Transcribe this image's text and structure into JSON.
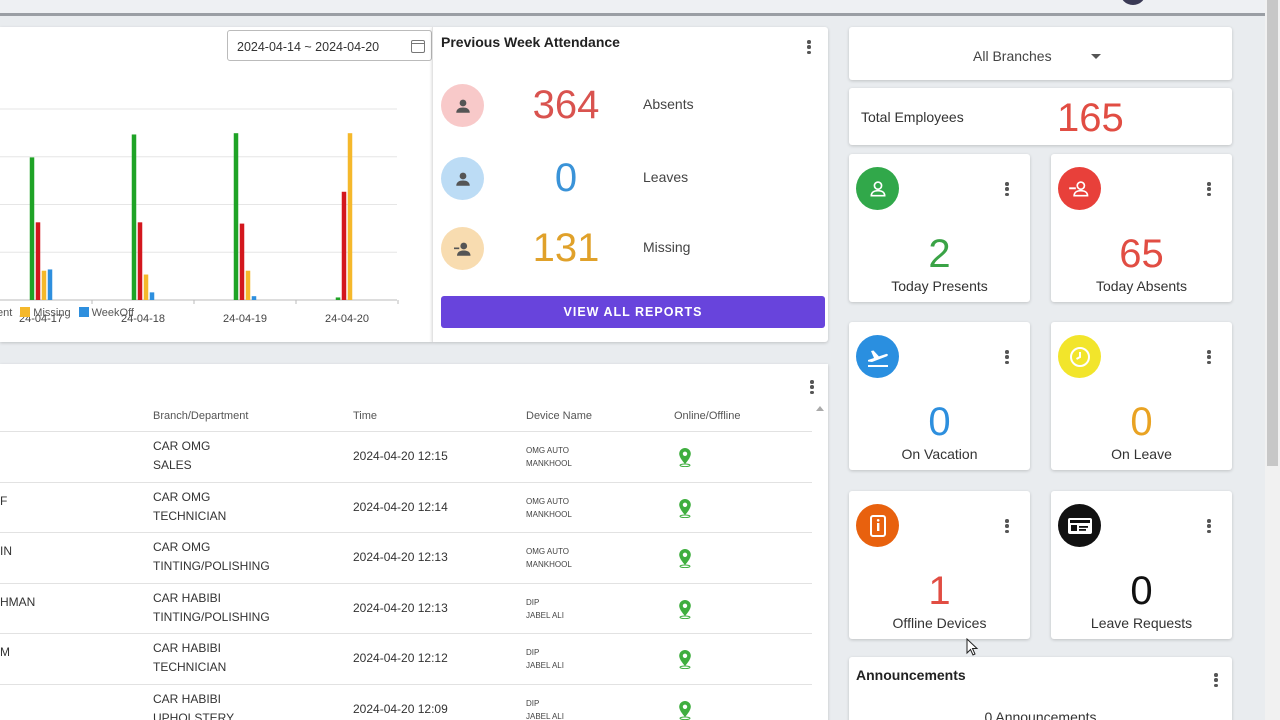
{
  "date_range": "2024-04-14 ~ 2024-04-20",
  "chart_data": {
    "type": "bar",
    "categories": [
      "24-04-17",
      "24-04-18",
      "24-04-19",
      "24-04-20"
    ],
    "series": [
      {
        "name": "Present",
        "color": "#1fa326",
        "values": [
          112,
          130,
          131,
          2
        ]
      },
      {
        "name": "Absent",
        "color": "#d3171d",
        "values": [
          61,
          61,
          60,
          85
        ]
      },
      {
        "name": "Missing",
        "color": "#f5b82b",
        "values": [
          23,
          20,
          23,
          131
        ]
      },
      {
        "name": "WeekOff",
        "color": "#2e8fde",
        "values": [
          24,
          6,
          3,
          0
        ]
      }
    ],
    "legend_visible": [
      "ent",
      "Missing",
      "WeekOff"
    ],
    "ylim": [
      0,
      150
    ],
    "grid": true
  },
  "previous_week": {
    "title": "Previous Week Attendance",
    "rows": [
      {
        "value": "364",
        "label": "Absents",
        "color": "#d9534f",
        "bg": "#f8c9c9",
        "icon": "user-icon"
      },
      {
        "value": "0",
        "label": "Leaves",
        "color": "#3a93d8",
        "bg": "#bcdcf5",
        "icon": "user-icon"
      },
      {
        "value": "131",
        "label": "Missing",
        "color": "#e0a12a",
        "bg": "#f8dcb0",
        "icon": "user-minus-icon"
      }
    ],
    "button": "VIEW ALL REPORTS"
  },
  "table": {
    "headers": {
      "branch": "Branch/Department",
      "time": "Time",
      "device": "Device Name",
      "status": "Online/Offline"
    },
    "rows": [
      {
        "name": "",
        "branch": "CAR OMG",
        "dept": "SALES",
        "time": "2024-04-20 12:15",
        "device1": "OMG AUTO",
        "device2": "MANKHOOL"
      },
      {
        "name": "F",
        "branch": "CAR OMG",
        "dept": "TECHNICIAN",
        "time": "2024-04-20 12:14",
        "device1": "OMG AUTO",
        "device2": "MANKHOOL"
      },
      {
        "name": "IN",
        "branch": "CAR OMG",
        "dept": "TINTING/POLISHING",
        "time": "2024-04-20 12:13",
        "device1": "OMG AUTO",
        "device2": "MANKHOOL"
      },
      {
        "name": "HMAN",
        "branch": "CAR HABIBI",
        "dept": "TINTING/POLISHING",
        "time": "2024-04-20 12:13",
        "device1": "DIP",
        "device2": "JABEL ALI"
      },
      {
        "name": "M",
        "branch": "CAR HABIBI",
        "dept": "TECHNICIAN",
        "time": "2024-04-20 12:12",
        "device1": "DIP",
        "device2": "JABEL ALI"
      },
      {
        "name": "",
        "branch": "CAR HABIBI",
        "dept": "UPHOLSTERY",
        "time": "2024-04-20 12:09",
        "device1": "DIP",
        "device2": "JABEL ALI"
      }
    ]
  },
  "branch_select": "All Branches",
  "total": {
    "label": "Total Employees",
    "value": "165"
  },
  "stats": [
    {
      "value": "2",
      "label": "Today Presents",
      "color": "#3aa346",
      "icon_bg": "#31a84a",
      "icon": "user-icon"
    },
    {
      "value": "65",
      "label": "Today Absents",
      "color": "#e14d43",
      "icon_bg": "#e8403a",
      "icon": "user-minus-icon"
    },
    {
      "value": "0",
      "label": "On Vacation",
      "color": "#2d8fde",
      "icon_bg": "#2a8fe0",
      "icon": "plane-icon"
    },
    {
      "value": "0",
      "label": "On Leave",
      "color": "#e9a323",
      "icon_bg": "#f2e52b",
      "icon": "clock-icon"
    },
    {
      "value": "1",
      "label": "Offline Devices",
      "color": "#e14d43",
      "icon_bg": "#e8610e",
      "icon": "device-icon"
    },
    {
      "value": "0",
      "label": "Leave Requests",
      "color": "#111111",
      "icon_bg": "#111111",
      "icon": "id-card-icon"
    }
  ],
  "announcements": {
    "title": "Announcements",
    "count": "0 Announcements"
  }
}
